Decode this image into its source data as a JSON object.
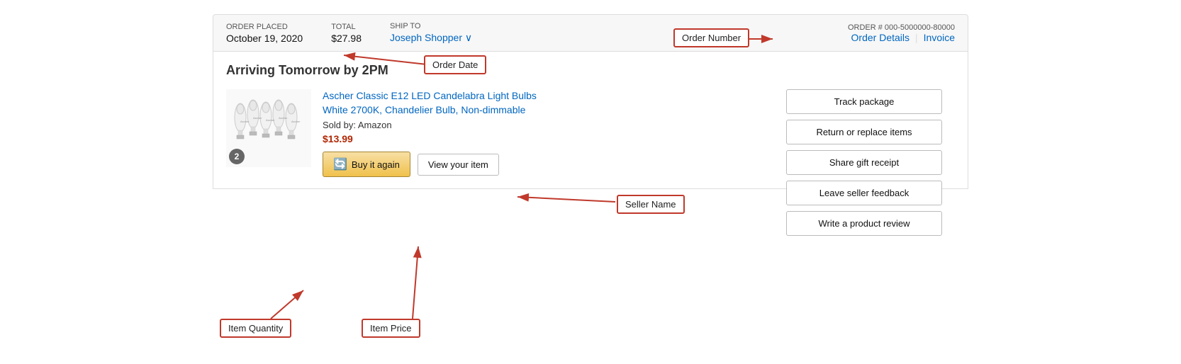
{
  "header": {
    "order_placed_label": "ORDER PLACED",
    "order_date": "October 19, 2020",
    "total_label": "TOTAL",
    "total_value": "$27.98",
    "ship_to_label": "SHIP TO",
    "ship_to_value": "Joseph Shopper",
    "ship_to_chevron": "∨",
    "order_num_label": "ORDER # 000-5000000-80000",
    "order_details_link": "Order Details",
    "invoice_link": "Invoice"
  },
  "body": {
    "arriving_text": "Arriving Tomorrow by 2PM",
    "item": {
      "title_line1": "Ascher Classic E12 LED Candelabra Light Bulbs",
      "title_line2": "White 2700K, Chandelier Bulb, Non-dimmable",
      "sold_by": "Sold by: Amazon",
      "price": "$13.99",
      "quantity": "2",
      "buy_again_label": "Buy it again",
      "view_item_label": "View your item"
    },
    "right_buttons": {
      "track": "Track package",
      "return": "Return or replace items",
      "gift": "Share gift receipt",
      "seller_feedback": "Leave seller feedback",
      "review": "Write a product review"
    }
  },
  "annotations": {
    "order_date_label": "Order Date",
    "order_number_label": "Order Number",
    "seller_name_label": "Seller Name",
    "item_quantity_label": "Item Quantity",
    "item_price_label": "Item Price"
  }
}
